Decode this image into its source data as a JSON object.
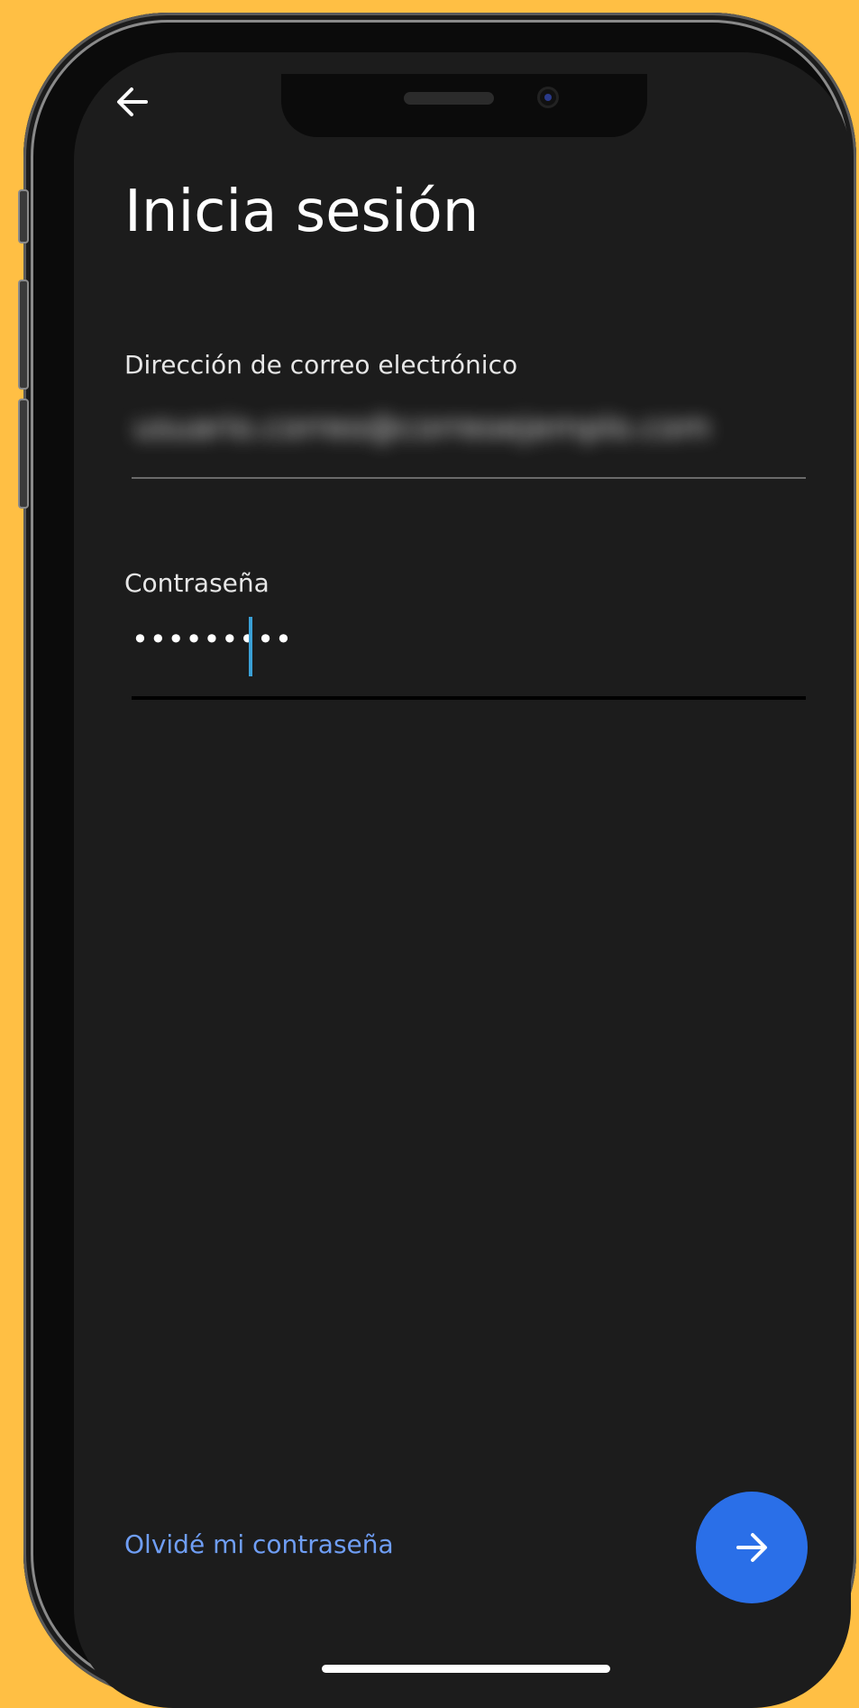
{
  "screen": {
    "title": "Inicia sesión"
  },
  "email_field": {
    "label": "Dirección de correo electrónico",
    "value": "usuario.correo@correoejemplo.com"
  },
  "password_field": {
    "label": "Contraseña",
    "value": "•••••••••"
  },
  "forgot_link": {
    "label": "Olvidé mi contraseña"
  },
  "icons": {
    "back": "arrow-left-icon",
    "next": "arrow-right-icon"
  },
  "colors": {
    "background": "#FFBF44",
    "screen": "#1C1C1C",
    "accent_blue": "#2A6FE8",
    "link_blue": "#6F9EF5",
    "caret": "#3AA0D6"
  }
}
